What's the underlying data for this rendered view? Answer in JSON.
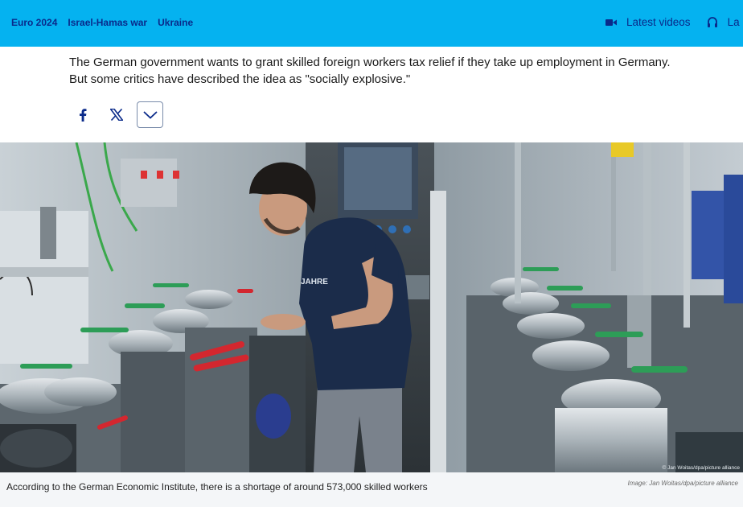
{
  "nav": {
    "links": [
      "Euro 2024",
      "Israel-Hamas war",
      "Ukraine"
    ],
    "latest_videos": "Latest videos",
    "latest_audio_truncated": "La"
  },
  "article": {
    "teaser": "The German government wants to grant skilled foreign workers tax relief if they take up employment in Germany. But some critics have described the idea as \"socially explosive.\""
  },
  "share": {
    "icons": [
      "facebook-icon",
      "x-icon",
      "chevron-down-icon"
    ]
  },
  "image": {
    "shirt_text": "JAHRE",
    "overlay_credit": "© Jan Woitas/dpa/picture alliance",
    "caption": "According to the German Economic Institute, there is a shortage of around 573,000 skilled workers",
    "credit": "Image: Jan Woitas/dpa/picture alliance"
  },
  "colors": {
    "header_bg": "#05b2f0",
    "nav_text": "#0a2a8a",
    "caption_bg": "#f4f6f8"
  }
}
